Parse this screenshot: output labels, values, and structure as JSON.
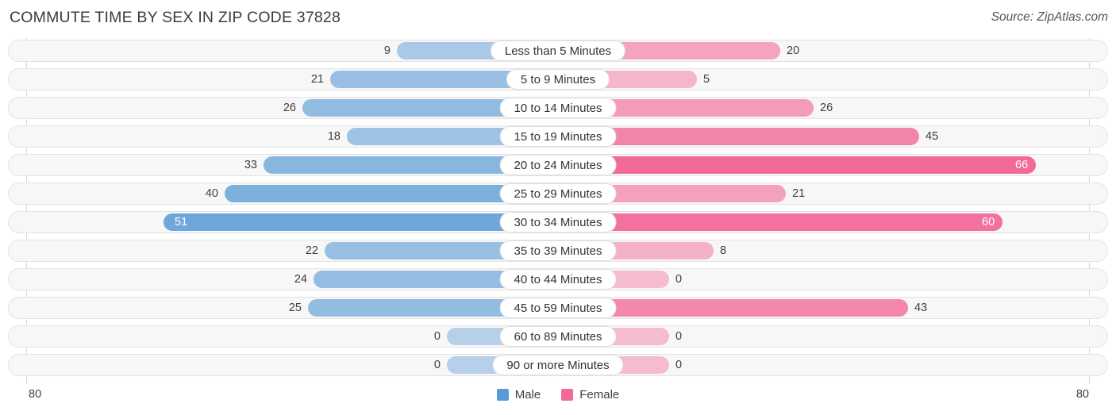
{
  "header": {
    "title": "COMMUTE TIME BY SEX IN ZIP CODE 37828",
    "source": "Source: ZipAtlas.com"
  },
  "axis": {
    "left_max": "80",
    "right_max": "80"
  },
  "legend": {
    "items": [
      {
        "label": "Male",
        "color": "#5b9bd5"
      },
      {
        "label": "Female",
        "color": "#f2699a"
      }
    ]
  },
  "chart_data": {
    "type": "bar",
    "title": "COMMUTE TIME BY SEX IN ZIP CODE 37828",
    "subtitle": "Source: ZipAtlas.com",
    "orientation": "horizontal-diverging",
    "xlabel": "",
    "ylabel": "",
    "xlim": [
      0,
      80
    ],
    "grid": false,
    "legend_position": "bottom-center",
    "categories": [
      "Less than 5 Minutes",
      "5 to 9 Minutes",
      "10 to 14 Minutes",
      "15 to 19 Minutes",
      "20 to 24 Minutes",
      "25 to 29 Minutes",
      "30 to 34 Minutes",
      "35 to 39 Minutes",
      "40 to 44 Minutes",
      "45 to 59 Minutes",
      "60 to 89 Minutes",
      "90 or more Minutes"
    ],
    "series": [
      {
        "name": "Male",
        "color": "#5b9bd5",
        "side": "left",
        "values": [
          9,
          21,
          26,
          18,
          33,
          40,
          51,
          22,
          24,
          25,
          0,
          0
        ]
      },
      {
        "name": "Female",
        "color": "#f2699a",
        "side": "right",
        "values": [
          20,
          5,
          26,
          45,
          66,
          21,
          60,
          8,
          0,
          43,
          0,
          0
        ]
      }
    ]
  }
}
